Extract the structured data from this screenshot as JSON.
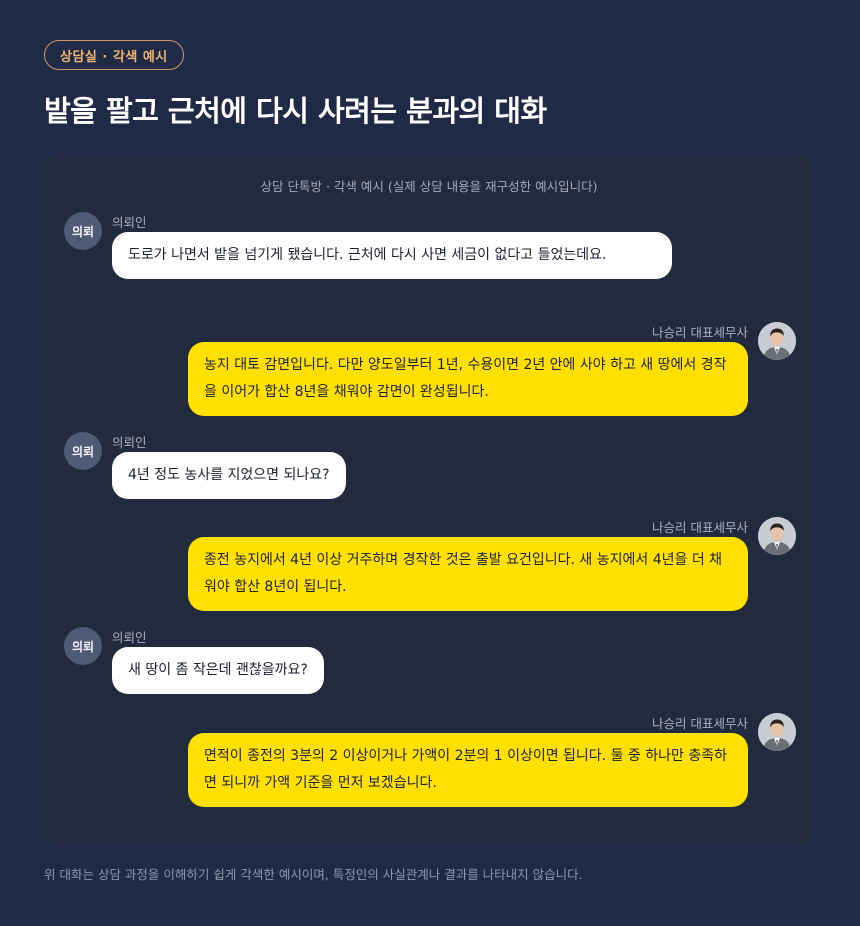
{
  "badge": "상담실 · 각색 예시",
  "title": "밭을 팔고 근처에 다시 사려는 분과의 대화",
  "chat": {
    "header": "상담 단톡방 · 각색 예시 (실제 상담 내용을 재구성한 예시입니다)",
    "client_avatar": "의뢰",
    "messages": [
      {
        "role": "client",
        "name": "의뢰인",
        "text": "도로가 나면서 밭을 넘기게 됐습니다. 근처에 다시 사면 세금이 없다고 들었는데요."
      },
      {
        "role": "advisor",
        "name": "나승리 대표세무사",
        "text": "농지 대토 감면입니다. 다만 양도일부터 1년, 수용이면 2년 안에 사야 하고 새 땅에서 경작을 이어가 합산 8년을 채워야 감면이 완성됩니다."
      },
      {
        "role": "client",
        "name": "의뢰인",
        "text": "4년 정도 농사를 지었으면 되나요?"
      },
      {
        "role": "advisor",
        "name": "나승리 대표세무사",
        "text": "종전 농지에서 4년 이상 거주하며 경작한 것은 출발 요건입니다. 새 농지에서 4년을 더 채워야 합산 8년이 됩니다."
      },
      {
        "role": "client",
        "name": "의뢰인",
        "text": "새 땅이 좀 작은데 괜찮을까요?"
      },
      {
        "role": "advisor",
        "name": "나승리 대표세무사",
        "text": "면적이 종전의 3분의 2 이상이거나 가액이 2분의 1 이상이면 됩니다. 둘 중 하나만 충족하면 되니까 가액 기준을 먼저 보겠습니다."
      }
    ]
  },
  "footer": "위 대화는 상담 과정을 이해하기 쉽게 각색한 예시이며, 특정인의 사실관계나 결과를 나타내지 않습니다.",
  "colors": {
    "background": "#1f2a47",
    "panel": "#222b3d",
    "badge_accent": "#f0b56e",
    "client_bubble": "#ffffff",
    "advisor_bubble": "#ffe000"
  }
}
